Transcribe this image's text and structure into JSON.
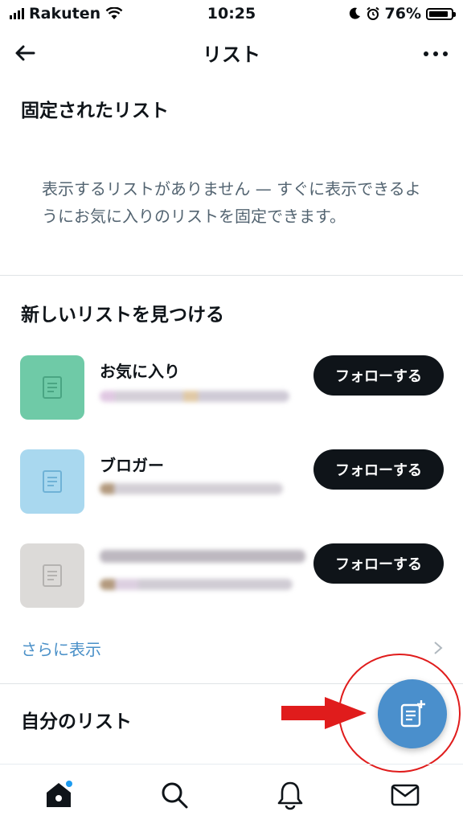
{
  "status_bar": {
    "carrier": "Rakuten",
    "time": "10:25",
    "battery": "76%",
    "battery_level": 0.76,
    "icons": [
      "signal-icon",
      "wifi-icon",
      "moon-icon",
      "alarm-icon",
      "battery-icon"
    ]
  },
  "header": {
    "title": "リスト",
    "back_icon": "arrow-left-icon",
    "more_icon": "more-dots-icon"
  },
  "pinned": {
    "title": "固定されたリスト",
    "empty_message": "表示するリストがありません — すぐに表示できるようにお気に入りのリストを固定できます。"
  },
  "discover": {
    "title": "新しいリストを見つける",
    "items": [
      {
        "name": "お気に入り",
        "thumb_color": "#6fcaa7",
        "follow_label": "フォローする"
      },
      {
        "name": "ブロガー",
        "thumb_color": "#a9d8ef",
        "follow_label": "フォローする"
      },
      {
        "name": "",
        "thumb_color": "#dcdad8",
        "follow_label": "フォローする"
      }
    ],
    "show_more": "さらに表示"
  },
  "my_lists": {
    "title": "自分のリスト"
  },
  "fab": {
    "icon": "new-list-icon",
    "color": "#4a8fcc"
  },
  "annotation": {
    "color": "#e01c1c"
  },
  "bottom_nav": {
    "items": [
      "home-icon",
      "search-icon",
      "bell-icon",
      "mail-icon"
    ],
    "accent": "#1d9bf0"
  }
}
